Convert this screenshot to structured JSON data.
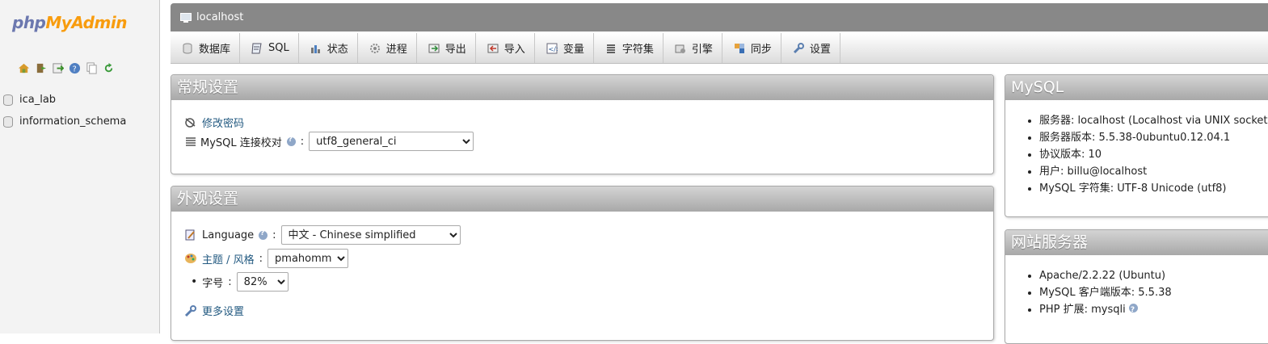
{
  "nav": {
    "logo_php": "php",
    "logo_myadmin": "MyAdmin",
    "icons": [
      "home-icon",
      "exit-icon",
      "query-icon",
      "docs-icon",
      "copy-icon",
      "reload-icon"
    ],
    "databases": [
      "ica_lab",
      "information_schema"
    ]
  },
  "serverbar": {
    "title": "localhost"
  },
  "tabs": [
    {
      "label": "数据库",
      "icon": "database-icon"
    },
    {
      "label": "SQL",
      "icon": "sql-icon"
    },
    {
      "label": "状态",
      "icon": "status-icon"
    },
    {
      "label": "进程",
      "icon": "process-icon"
    },
    {
      "label": "导出",
      "icon": "export-icon"
    },
    {
      "label": "导入",
      "icon": "import-icon"
    },
    {
      "label": "变量",
      "icon": "variables-icon"
    },
    {
      "label": "字符集",
      "icon": "charset-icon"
    },
    {
      "label": "引擎",
      "icon": "engine-icon"
    },
    {
      "label": "同步",
      "icon": "sync-icon"
    },
    {
      "label": "设置",
      "icon": "settings-icon"
    }
  ],
  "general": {
    "title": "常规设置",
    "change_password": "修改密码",
    "collation_label": "MySQL 连接校对",
    "collation_value": "utf8_general_ci",
    "colon": ":"
  },
  "appearance": {
    "title": "外观设置",
    "language_label": "Language",
    "language_value": "中文 - Chinese simplified",
    "theme_label": "主题 / 风格",
    "theme_value": "pmahomme",
    "fontsize_label": "字号",
    "fontsize_value": "82%",
    "more_settings": "更多设置",
    "colon": ":"
  },
  "mysql_panel": {
    "title": "MySQL",
    "items": [
      "服务器: localhost (Localhost via UNIX socket)",
      "服务器版本: 5.5.38-0ubuntu0.12.04.1",
      "协议版本: 10",
      "用户: billu@localhost",
      "MySQL 字符集: UTF-8 Unicode (utf8)"
    ]
  },
  "web_panel": {
    "title": "网站服务器",
    "items": [
      "Apache/2.2.22 (Ubuntu)",
      "MySQL 客户端版本: 5.5.38",
      "PHP 扩展: mysqli"
    ]
  },
  "colors": {
    "accent_link": "#235a81",
    "header_gray": "#888888",
    "logo_blue": "#6c78af",
    "logo_orange": "#f89c0e"
  }
}
